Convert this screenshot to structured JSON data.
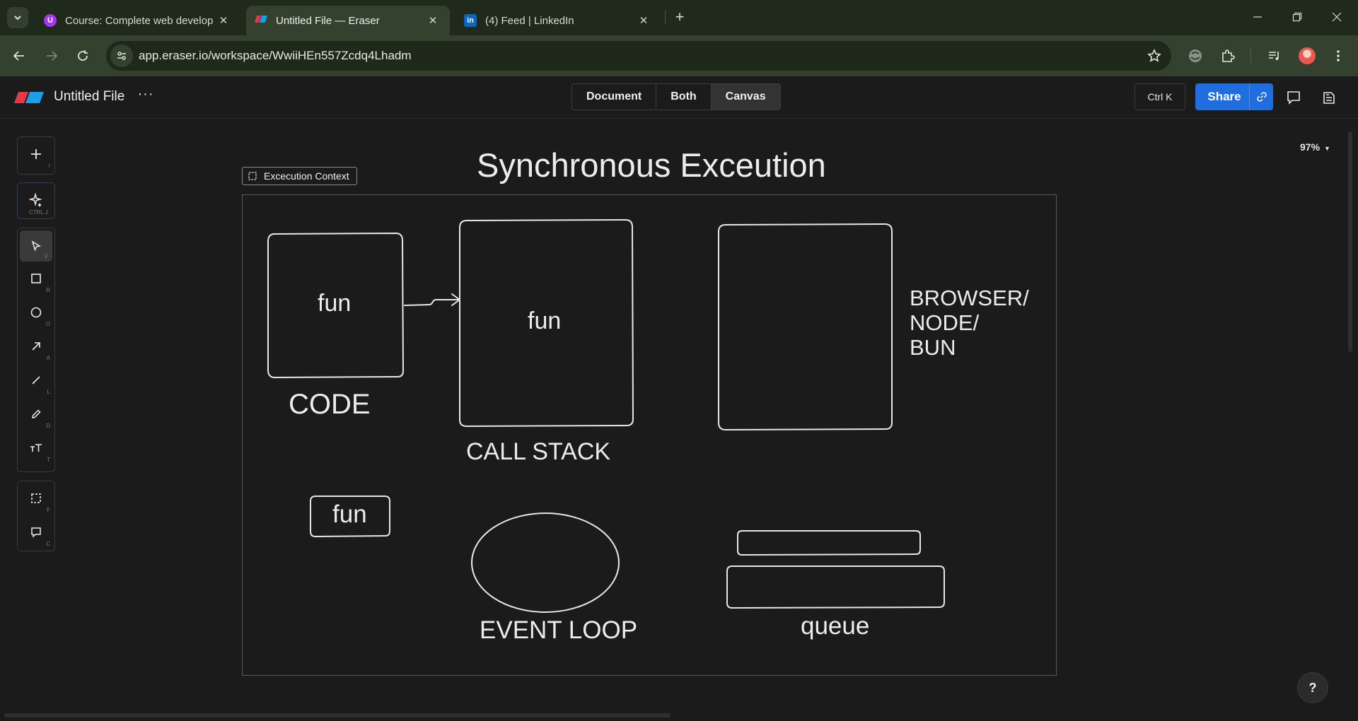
{
  "browser": {
    "tabs": [
      {
        "title": "Course: Complete web develop",
        "favicon": "udemy-icon",
        "active": false
      },
      {
        "title": "Untitled File — Eraser",
        "favicon": "eraser-icon",
        "active": true
      },
      {
        "title": "(4) Feed | LinkedIn",
        "favicon": "linkedin-icon",
        "active": false
      }
    ],
    "url": "app.eraser.io/workspace/WwiiHEn557Zcdq4Lhadm"
  },
  "app": {
    "file_name": "Untitled File",
    "view_modes": [
      "Document",
      "Both",
      "Canvas"
    ],
    "selected_view": "Canvas",
    "shortcut_label": "Ctrl K",
    "share_label": "Share",
    "zoom": "97%",
    "help_label": "?"
  },
  "toolbar": {
    "add": {
      "icon": "plus-icon",
      "key": "/"
    },
    "ai": {
      "icon": "sparkle-icon",
      "key": "CTRL J"
    },
    "tools": [
      {
        "name": "select",
        "icon": "pointer-icon",
        "key": "V",
        "selected": true
      },
      {
        "name": "rectangle",
        "icon": "square-icon",
        "key": "R"
      },
      {
        "name": "ellipse",
        "icon": "circle-icon",
        "key": "O"
      },
      {
        "name": "arrow",
        "icon": "arrow-icon",
        "key": "A"
      },
      {
        "name": "line",
        "icon": "line-icon",
        "key": "L"
      },
      {
        "name": "pen",
        "icon": "pencil-icon",
        "key": "D"
      },
      {
        "name": "text",
        "icon": "text-icon",
        "key": "T"
      }
    ],
    "extras": [
      {
        "name": "frame",
        "icon": "frame-icon",
        "key": "F"
      },
      {
        "name": "comment",
        "icon": "comment-icon",
        "key": "C"
      }
    ]
  },
  "canvas": {
    "title": "Synchronous Exceution",
    "frame_label": "Excecution Context",
    "code_box_text": "fun",
    "code_label": "CODE",
    "call_stack_box_text": "fun",
    "call_stack_label": "CALL STACK",
    "runtime_label_lines": [
      "BROWSER/",
      "NODE/",
      "BUN"
    ],
    "small_box_text": "fun",
    "event_loop_label": "EVENT LOOP",
    "queue_label": "queue"
  }
}
